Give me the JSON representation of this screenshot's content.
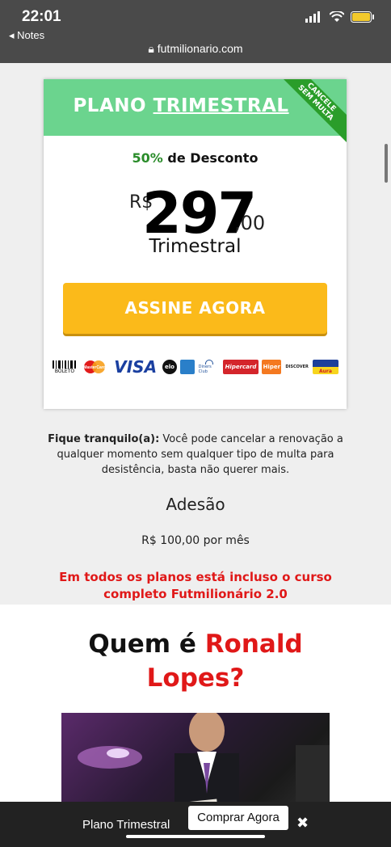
{
  "statusbar": {
    "time": "22:01",
    "back_label": "◂ Notes",
    "url": "futmilionario.com"
  },
  "plan": {
    "title_prefix": "PLANO",
    "title_emph": "TRIMESTRAL",
    "ribbon_line1": "CANCELE",
    "ribbon_line2": "SEM MULTA",
    "discount_pct": "50%",
    "discount_text": "de Desconto",
    "currency": "R$",
    "amount": "297",
    "cents": ",00",
    "period": "Trimestral",
    "cta_label": "ASSINE AGORA"
  },
  "payments": [
    "BOLETO",
    "MasterCard",
    "VISA",
    "elo",
    "Amex",
    "Diners Club",
    "Hipercard",
    "Hiper",
    "DISCOVER",
    "Aura"
  ],
  "info": {
    "note_bold": "Fique tranquilo(a):",
    "note_text": " Você pode cancelar a renovação a qualquer momento sem qualquer tipo de multa para desistência, basta não querer mais.",
    "adesao": "Adesão",
    "monthly": "R$ 100,00 por mês",
    "included": "Em todos os planos está incluso o curso completo Futmilionário 2.0"
  },
  "about": {
    "who_prefix": "Quem é",
    "who_name": "Ronald Lopes?"
  },
  "bottombar": {
    "label": "Plano Trimestral",
    "button": "Comprar Agora",
    "close": "✖"
  },
  "colors": {
    "header_green": "#6bd48e",
    "ribbon_green": "#2a9d2a",
    "cta_yellow": "#fbba1a",
    "accent_red": "#e01818"
  }
}
